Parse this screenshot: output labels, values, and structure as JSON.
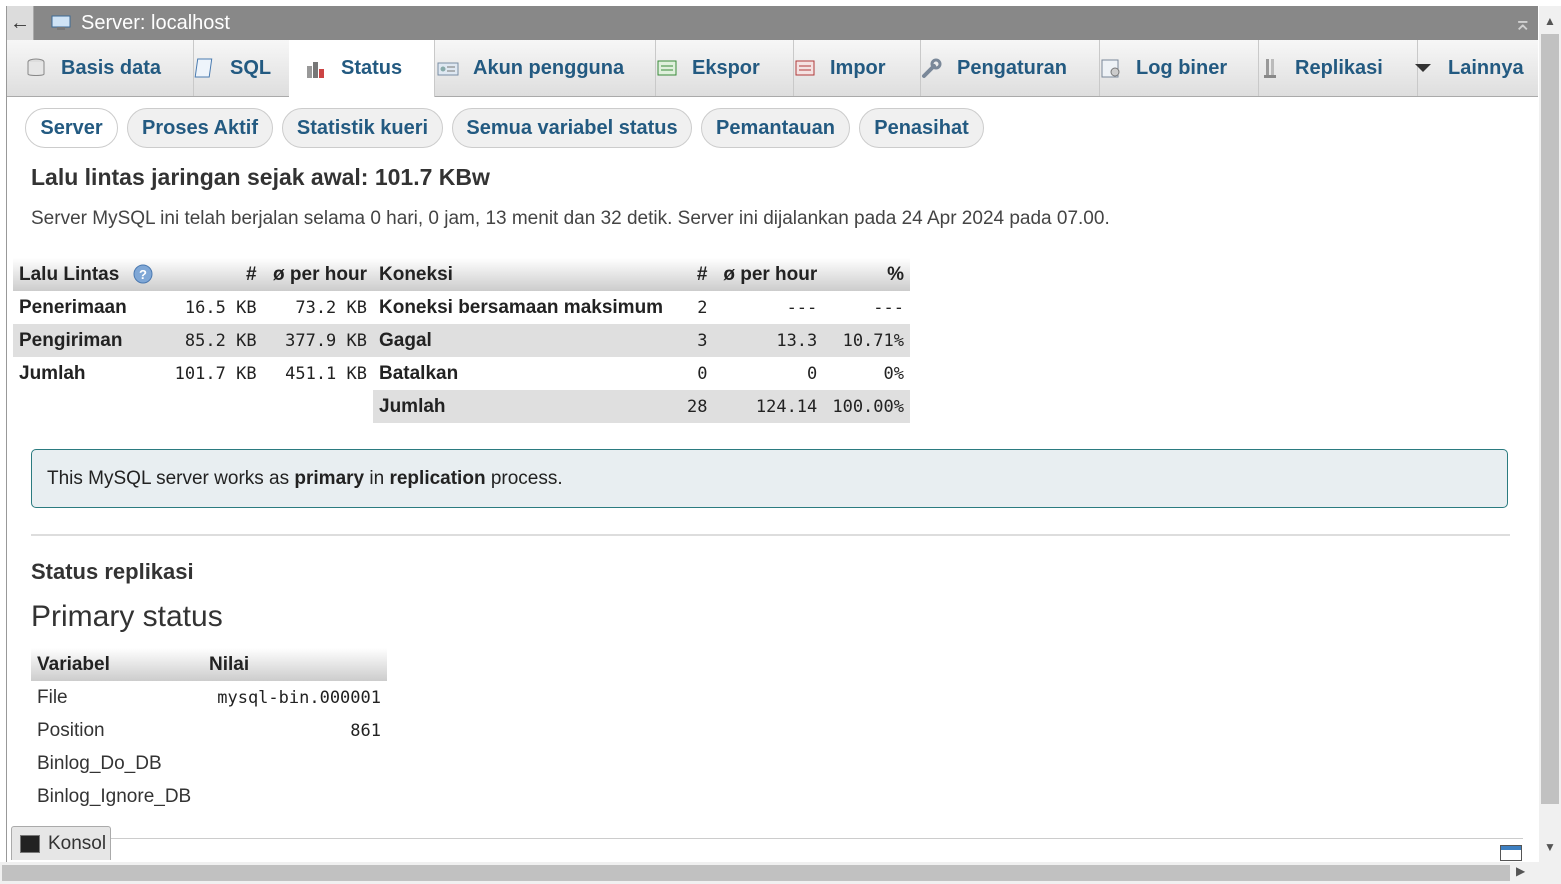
{
  "titlebar": {
    "back": "←",
    "title": "Server: localhost",
    "collapse": "⌅"
  },
  "tabs": [
    {
      "label": "Basis data",
      "icon": "database-icon"
    },
    {
      "label": "SQL",
      "icon": "sql-icon"
    },
    {
      "label": "Status",
      "icon": "status-icon"
    },
    {
      "label": "Akun pengguna",
      "icon": "user-accounts-icon"
    },
    {
      "label": "Ekspor",
      "icon": "export-icon"
    },
    {
      "label": "Impor",
      "icon": "import-icon"
    },
    {
      "label": "Pengaturan",
      "icon": "wrench-icon"
    },
    {
      "label": "Log biner",
      "icon": "binlog-icon"
    },
    {
      "label": "Replikasi",
      "icon": "replication-icon"
    },
    {
      "label": "Lainnya",
      "icon": "chevron-down-icon"
    }
  ],
  "subtabs": [
    "Server",
    "Proses Aktif",
    "Statistik kueri",
    "Semua variabel status",
    "Pemantauan",
    "Penasihat"
  ],
  "heading": "Lalu lintas jaringan sejak awal: 101.7 KBw",
  "uptime": "Server MySQL ini telah berjalan selama 0 hari, 0 jam, 13 menit dan 32 detik. Server ini dijalankan pada 24 Apr 2024 pada 07.00.",
  "traffic": {
    "headers": [
      "Lalu Lintas",
      "#",
      "ø per hour"
    ],
    "rows": [
      [
        "Penerimaan",
        "16.5 KB",
        "73.2 KB"
      ],
      [
        "Pengiriman",
        "85.2 KB",
        "377.9 KB"
      ],
      [
        "Jumlah",
        "101.7 KB",
        "451.1 KB"
      ]
    ]
  },
  "connections": {
    "headers": [
      "Koneksi",
      "#",
      "ø per hour",
      "%"
    ],
    "rows": [
      [
        "Koneksi bersamaan maksimum",
        "2",
        "---",
        "---"
      ],
      [
        "Gagal",
        "3",
        "13.3",
        "10.71%"
      ],
      [
        "Batalkan",
        "0",
        "0",
        "0%"
      ],
      [
        "Jumlah",
        "28",
        "124.14",
        "100.00%"
      ]
    ]
  },
  "notice": {
    "pre": "This MySQL server works as ",
    "b1": "primary",
    "mid": " in ",
    "b2": "replication",
    "post": " process."
  },
  "replication_title": "Status replikasi",
  "primary_title": "Primary status",
  "primary": {
    "headers": [
      "Variabel",
      "Nilai"
    ],
    "rows": [
      [
        "File",
        "mysql-bin.000001"
      ],
      [
        "Position",
        "861"
      ],
      [
        "Binlog_Do_DB",
        ""
      ],
      [
        "Binlog_Ignore_DB",
        ""
      ]
    ]
  },
  "console": "Konsol"
}
